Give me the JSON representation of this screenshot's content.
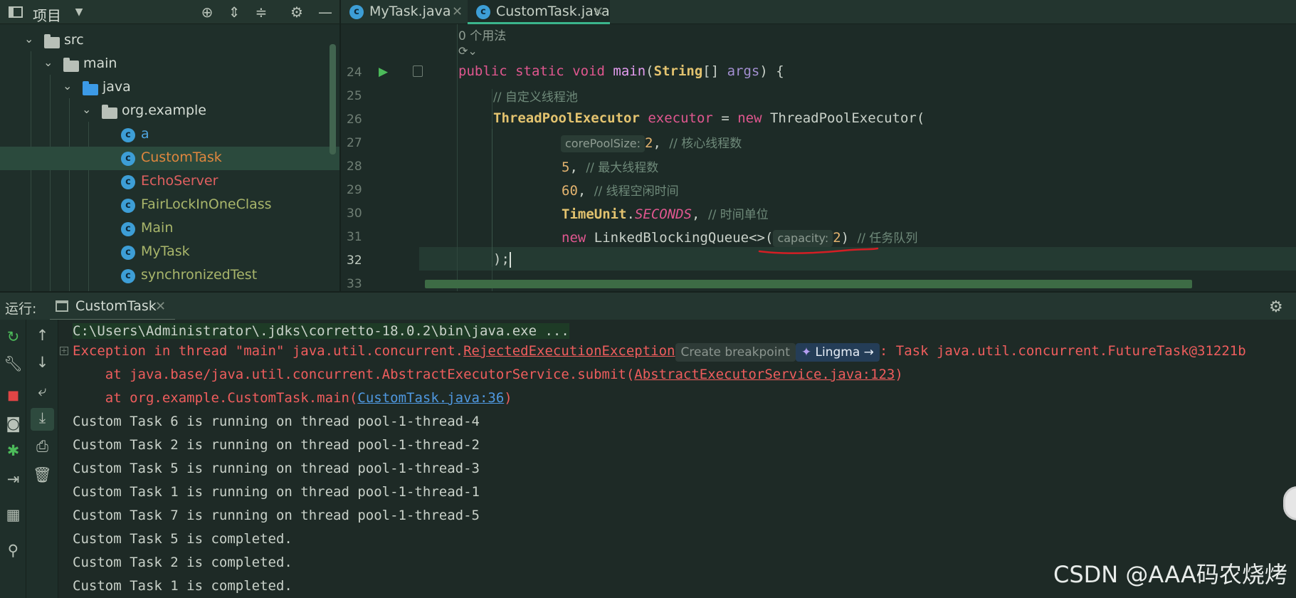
{
  "project_panel": {
    "title": "项目",
    "tree": [
      {
        "label": "src",
        "kind": "folder"
      },
      {
        "label": "main",
        "kind": "folder"
      },
      {
        "label": "java",
        "kind": "folder-blue"
      },
      {
        "label": "org.example",
        "kind": "package"
      },
      {
        "label": "a",
        "kind": "class"
      },
      {
        "label": "CustomTask",
        "kind": "class",
        "selected": true
      },
      {
        "label": "EchoServer",
        "kind": "class"
      },
      {
        "label": "FairLockInOneClass",
        "kind": "class"
      },
      {
        "label": "Main",
        "kind": "class"
      },
      {
        "label": "MyTask",
        "kind": "class"
      },
      {
        "label": "synchronizedTest",
        "kind": "class"
      }
    ],
    "colors": {
      "src": "#d4dcd4",
      "a": "#4fa5e0",
      "CustomTask": "#e0873e",
      "EchoServer": "#e06060",
      "FairLockInOneClass": "#a9b66b",
      "Main": "#a9b66b",
      "MyTask": "#a9b66b",
      "synchronizedTest": "#a9b66b"
    }
  },
  "editor": {
    "tabs": [
      {
        "label": "MyTask.java",
        "active": false
      },
      {
        "label": "CustomTask.java",
        "active": true
      }
    ],
    "usage_hint": "0 个用法",
    "line_numbers": [
      "24",
      "25",
      "26",
      "27",
      "28",
      "29",
      "30",
      "31",
      "32",
      "33"
    ],
    "code": {
      "l24": {
        "kw1": "public",
        "kw2": "static",
        "kw3": "void",
        "name": "main",
        "open": "(",
        "type": "String",
        "rest": "[] ",
        "param": "args",
        "close": ") {"
      },
      "l25": {
        "comment": "// 自定义线程池"
      },
      "l26": {
        "type": "ThreadPoolExecutor",
        "var": "executor",
        "eq": " = ",
        "kw": "new",
        "ctor": " ThreadPoolExecutor("
      },
      "l27": {
        "hint": "corePoolSize:",
        "value": "2",
        "rest": ", ",
        "comment": "// 核心线程数"
      },
      "l28": {
        "value": "5",
        "rest": ", ",
        "comment": "// 最大线程数"
      },
      "l29": {
        "value": "60",
        "rest": ", ",
        "comment": "// 线程空闲时间"
      },
      "l30": {
        "type": "TimeUnit",
        "dot": ".",
        "field": "SECONDS",
        "rest": ", ",
        "comment": "// 时间单位"
      },
      "l31": {
        "kw": "new",
        "ctor": " LinkedBlockingQueue<>(",
        "hint": "capacity:",
        "value": "2",
        "rest": ") ",
        "comment": "// 任务队列"
      },
      "l32": {
        "text": ");"
      }
    }
  },
  "run_panel": {
    "label": "运行:",
    "tab": "CustomTask",
    "console": {
      "cmd": "C:\\Users\\Administrator\\.jdks\\corretto-18.0.2\\bin\\java.exe ...",
      "exception_prefix": "Exception in thread \"main\" java.util.concurrent.",
      "exception_class": "RejectedExecutionException",
      "create_breakpoint": "Create breakpoint",
      "lingma": "Lingma →",
      "exception_suffix": ": Task java.util.concurrent.FutureTask@31221b",
      "at1_prefix": "    at java.base/java.util.concurrent.AbstractExecutorService.submit(",
      "at1_link": "AbstractExecutorService.java:123",
      "at1_suffix": ")",
      "at2_prefix": "    at org.example.CustomTask.main(",
      "at2_link": "CustomTask.java:36",
      "at2_suffix": ")",
      "output": [
        "Custom Task 6 is running on thread pool-1-thread-4",
        "Custom Task 2 is running on thread pool-1-thread-2",
        "Custom Task 5 is running on thread pool-1-thread-3",
        "Custom Task 1 is running on thread pool-1-thread-1",
        "Custom Task 7 is running on thread pool-1-thread-5",
        "Custom Task 5 is completed.",
        "Custom Task 2 is completed.",
        "Custom Task 1 is completed."
      ]
    }
  },
  "watermark": "CSDN @AAA码农烧烤"
}
